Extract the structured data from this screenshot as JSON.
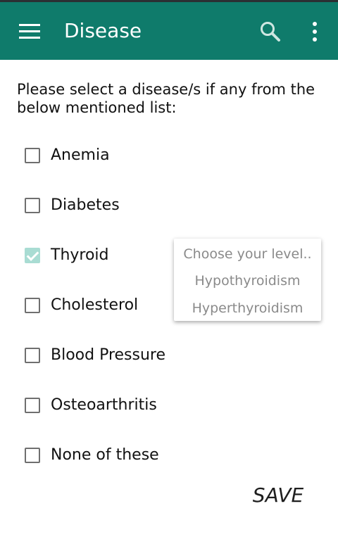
{
  "colors": {
    "app_bar": "#0f7b6b",
    "checked_checkbox": "#a9dcd3",
    "unchecked_border": "#6f6f6f",
    "popup_text": "#8a8a8a"
  },
  "app_bar": {
    "title": "Disease",
    "menu_icon": "hamburger-menu-icon",
    "search_icon": "search-icon",
    "more_icon": "more-vertical-icon"
  },
  "prompt": "Please select a disease/s if any from the below mentioned list:",
  "options": [
    {
      "label": "Anemia",
      "checked": false
    },
    {
      "label": "Diabetes",
      "checked": false
    },
    {
      "label": "Thyroid",
      "checked": true
    },
    {
      "label": "Cholesterol",
      "checked": false
    },
    {
      "label": "Blood Pressure",
      "checked": false
    },
    {
      "label": "Osteoarthritis",
      "checked": false
    },
    {
      "label": "None of these",
      "checked": false
    }
  ],
  "thyroid_popup": {
    "header": "Choose your level..",
    "items": [
      "Hypothyroidism",
      "Hyperthyroidism"
    ]
  },
  "save_label": "SAVE"
}
